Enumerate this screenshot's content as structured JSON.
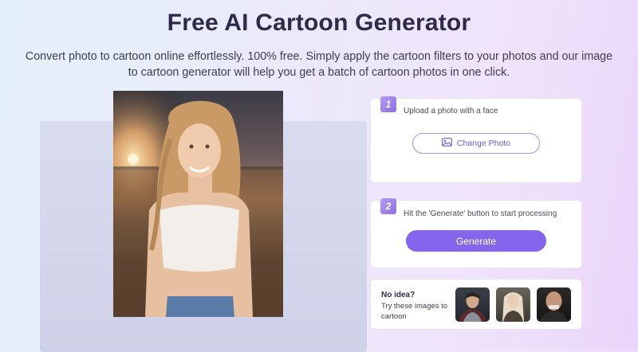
{
  "header": {
    "title": "Free AI Cartoon Generator",
    "subtitle": "Convert photo to cartoon online effortlessly. 100% free. Simply apply the cartoon filters to your photos and our image to cartoon generator will help you get a batch of cartoon photos in one click."
  },
  "step1": {
    "number": "1",
    "text": "Upload a photo with a face",
    "button_label": "Change Photo",
    "button_icon": "image-icon"
  },
  "step2": {
    "number": "2",
    "text": "Hit the 'Generate' button to start processing",
    "button_label": "Generate"
  },
  "samples": {
    "title": "No idea?",
    "text": "Try these images to cartoon",
    "images": [
      "armored-man-portrait",
      "blonde-woman-portrait",
      "bald-man-portrait"
    ]
  },
  "colors": {
    "accent": "#8565ec",
    "title": "#2f2a4a"
  }
}
